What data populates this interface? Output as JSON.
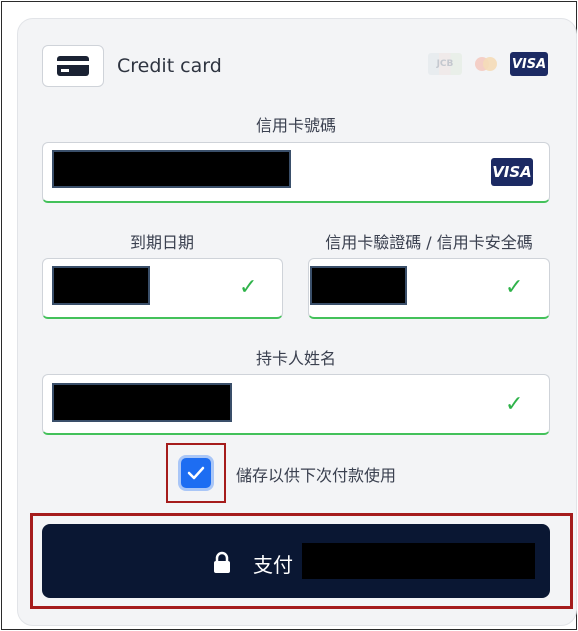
{
  "header": {
    "title": "Credit card",
    "card_icon": "credit-card-icon",
    "brands": {
      "jcb": "JCB",
      "mastercard": "mastercard-logo",
      "visa": "VISA"
    }
  },
  "fields": {
    "card_number": {
      "label": "信用卡號碼",
      "brand_badge": "VISA"
    },
    "expiry": {
      "label": "到期日期"
    },
    "cvc": {
      "label": "信用卡驗證碼 / 信用卡安全碼"
    },
    "holder": {
      "label": "持卡人姓名"
    }
  },
  "save_option": {
    "label": "儲存以供下次付款使用",
    "checked": true
  },
  "pay_button": {
    "label": "支付",
    "icon": "lock-icon"
  },
  "colors": {
    "accent_blue": "#1d6df2",
    "pay_bg": "#0a1733",
    "valid_green": "#43c15a",
    "highlight_red": "#a51c1c",
    "visa_blue": "#1c2a63"
  }
}
